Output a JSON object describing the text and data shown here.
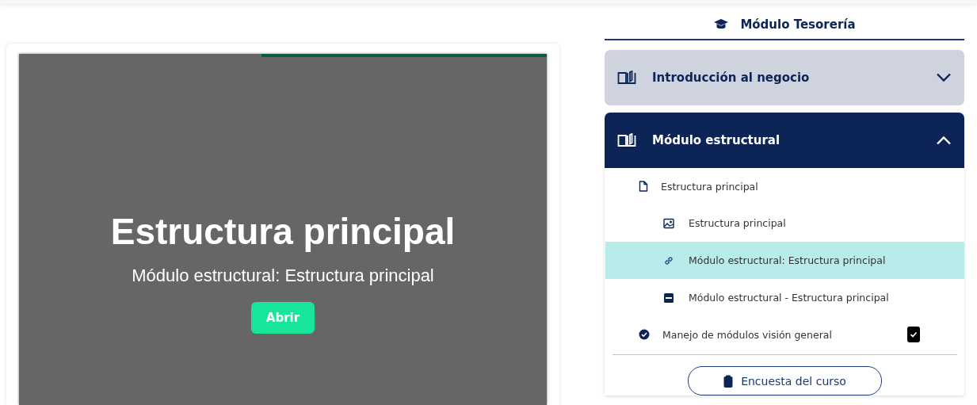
{
  "viewer": {
    "title": "Estructura principal",
    "subtitle": "Módulo estructural: Estructura principal",
    "open_button": "Abrir"
  },
  "sidebar": {
    "title": "Módulo Tesorería",
    "modules": [
      {
        "title": "Introducción al negocio",
        "expanded": false
      },
      {
        "title": "Módulo estructural",
        "expanded": true,
        "items": [
          {
            "kind": "document",
            "label": "Estructura principal",
            "selected": false,
            "children": [
              {
                "kind": "image",
                "label": "Estructura principal",
                "selected": false
              },
              {
                "kind": "link",
                "label": "Módulo estructural: Estructura principal",
                "selected": true
              },
              {
                "kind": "pdf",
                "label": "Módulo estructural - Estructura principal",
                "selected": false
              }
            ]
          },
          {
            "kind": "completed",
            "label": "Manejo de módulos visión general",
            "selected": false,
            "checked": true
          }
        ]
      }
    ],
    "survey_button": "Encuesta del curso"
  }
}
